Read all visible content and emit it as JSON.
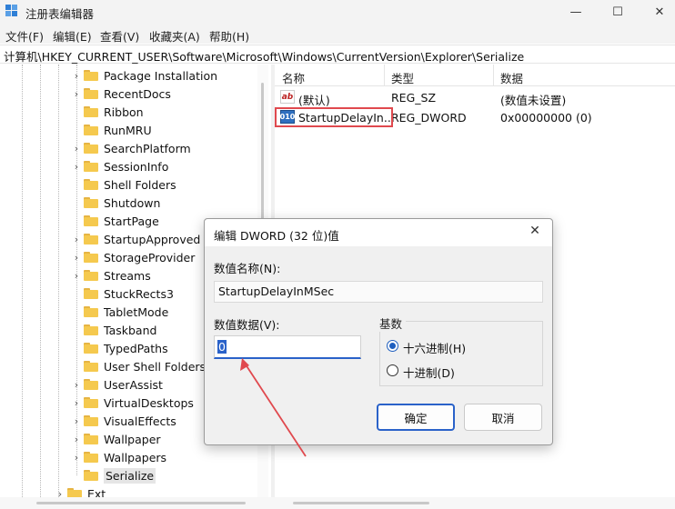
{
  "window": {
    "title": "注册表编辑器",
    "min_glyph": "—",
    "max_glyph": "☐",
    "close_glyph": "✕"
  },
  "menu": [
    "文件(F)",
    "编辑(E)",
    "查看(V)",
    "收藏夹(A)",
    "帮助(H)"
  ],
  "address": "计算机\\HKEY_CURRENT_USER\\Software\\Microsoft\\Windows\\CurrentVersion\\Explorer\\Serialize",
  "tree": {
    "items": [
      {
        "label": "Package Installation",
        "expandable": true
      },
      {
        "label": "RecentDocs",
        "expandable": true
      },
      {
        "label": "Ribbon",
        "expandable": false
      },
      {
        "label": "RunMRU",
        "expandable": false
      },
      {
        "label": "SearchPlatform",
        "expandable": true
      },
      {
        "label": "SessionInfo",
        "expandable": true
      },
      {
        "label": "Shell Folders",
        "expandable": false
      },
      {
        "label": "Shutdown",
        "expandable": false
      },
      {
        "label": "StartPage",
        "expandable": false
      },
      {
        "label": "StartupApproved",
        "expandable": true
      },
      {
        "label": "StorageProvider",
        "expandable": true
      },
      {
        "label": "Streams",
        "expandable": true
      },
      {
        "label": "StuckRects3",
        "expandable": false
      },
      {
        "label": "TabletMode",
        "expandable": false
      },
      {
        "label": "Taskband",
        "expandable": false
      },
      {
        "label": "TypedPaths",
        "expandable": false
      },
      {
        "label": "User Shell Folders",
        "expandable": false
      },
      {
        "label": "UserAssist",
        "expandable": true
      },
      {
        "label": "VirtualDesktops",
        "expandable": true
      },
      {
        "label": "VisualEffects",
        "expandable": true
      },
      {
        "label": "Wallpaper",
        "expandable": true
      },
      {
        "label": "Wallpapers",
        "expandable": true
      },
      {
        "label": "Serialize",
        "expandable": false,
        "selected": true
      }
    ],
    "partial_label": "Ext"
  },
  "list": {
    "headers": {
      "name": "名称",
      "type": "类型",
      "data": "数据"
    },
    "rows": [
      {
        "icon": "string-value-icon",
        "icon_text": "ab",
        "name": "(默认)",
        "type": "REG_SZ",
        "data": "(数值未设置)"
      },
      {
        "icon": "dword-value-icon",
        "icon_text": "010",
        "name": "StartupDelayIn...",
        "type": "REG_DWORD",
        "data": "0x00000000 (0)"
      }
    ]
  },
  "dialog": {
    "title": "编辑 DWORD (32 位)值",
    "close_glyph": "✕",
    "name_label": "数值名称(N):",
    "name_value": "StartupDelayInMSec",
    "value_label": "数值数据(V):",
    "value": "0",
    "base_label": "基数",
    "radio_hex": "十六进制(H)",
    "radio_dec": "十进制(D)",
    "selected_base": "hex",
    "ok": "确定",
    "cancel": "取消"
  },
  "colors": {
    "highlight_box": "#e0494e",
    "accent": "#2a62c9"
  }
}
